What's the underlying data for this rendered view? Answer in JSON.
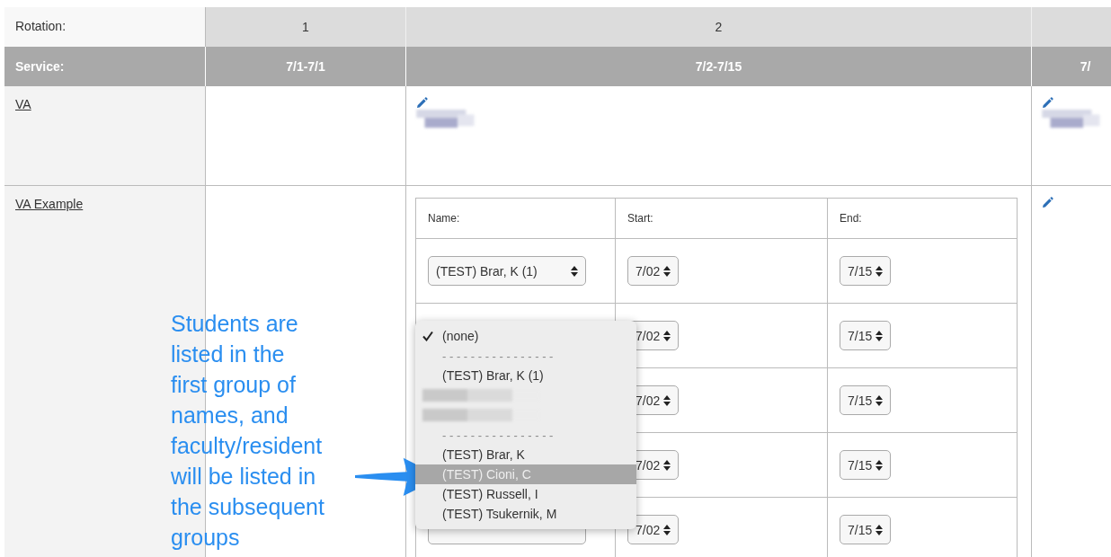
{
  "table": {
    "rotation_label": "Rotation:",
    "service_label": "Service:",
    "columns": [
      {
        "rotation": "1",
        "service": "7/1-7/1"
      },
      {
        "rotation": "2",
        "service": "7/2-7/15"
      },
      {
        "service": "7/"
      }
    ],
    "rows": [
      {
        "name": "VA",
        "cells": [
          {
            "kind": "empty"
          },
          {
            "kind": "assignment"
          },
          {
            "kind": "assignment"
          }
        ]
      },
      {
        "name": "VA Example",
        "cells": [
          {
            "kind": "empty"
          },
          {
            "kind": "form"
          },
          {
            "kind": "edit"
          }
        ]
      }
    ]
  },
  "form": {
    "columns": [
      "Name:",
      "Start:",
      "End:"
    ],
    "rows": [
      {
        "name": "(TEST) Brar, K (1)",
        "start": "7/02",
        "end": "7/15"
      },
      {
        "start": "7/02",
        "end": "7/15"
      },
      {
        "start": "7/02",
        "end": "7/15"
      },
      {
        "start": "7/02",
        "end": "7/15"
      },
      {
        "start": "7/02",
        "end": "7/15"
      }
    ]
  },
  "dropdown": {
    "options": [
      {
        "kind": "option",
        "label": "(none)",
        "checked": true,
        "selected": false
      },
      {
        "kind": "separator",
        "label": "- - - - - - - - - - - - - - - -"
      },
      {
        "kind": "option",
        "label": "(TEST) Brar, K (1)",
        "checked": false,
        "selected": false
      },
      {
        "kind": "redacted"
      },
      {
        "kind": "redacted"
      },
      {
        "kind": "separator",
        "label": "- - - - - - - - - - - - - - - -"
      },
      {
        "kind": "option",
        "label": "(TEST) Brar, K",
        "checked": false,
        "selected": false
      },
      {
        "kind": "option",
        "label": "(TEST) Cioni, C",
        "checked": false,
        "selected": true
      },
      {
        "kind": "option",
        "label": "(TEST) Russell, I",
        "checked": false,
        "selected": false
      },
      {
        "kind": "option",
        "label": "(TEST) Tsukernik, M",
        "checked": false,
        "selected": false
      }
    ]
  },
  "annotation": {
    "text": "Students are\nlisted in the\nfirst group of\nnames, and\nfaculty/resident\nwill be listed in\nthe subsequent\ngroups"
  }
}
